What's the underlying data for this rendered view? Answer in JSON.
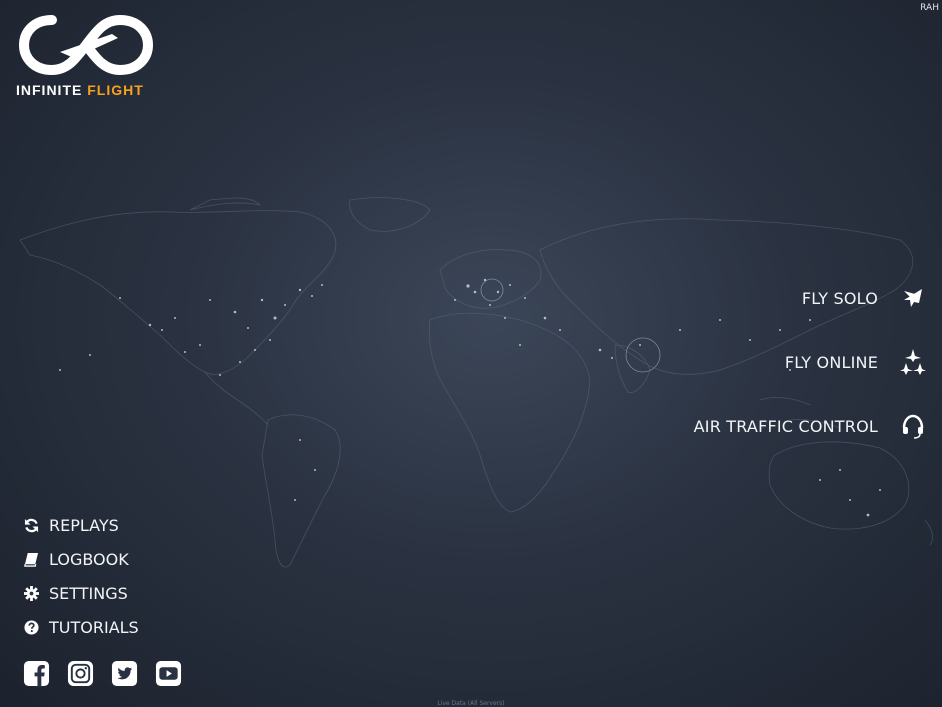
{
  "app": {
    "title": "Infinite Flight"
  },
  "user": {
    "badge": "RAH"
  },
  "logo": {
    "word1": "INFINITE",
    "word2": "FLIGHT",
    "accent_color": "#f6a21f"
  },
  "modes": [
    {
      "label": "FLY SOLO",
      "icon": "airplane-icon"
    },
    {
      "label": "FLY ONLINE",
      "icon": "multiplayer-planes-icon"
    },
    {
      "label": "AIR TRAFFIC CONTROL",
      "icon": "headset-icon"
    }
  ],
  "menu": [
    {
      "label": "REPLAYS",
      "icon": "refresh-icon"
    },
    {
      "label": "LOGBOOK",
      "icon": "book-icon"
    },
    {
      "label": "SETTINGS",
      "icon": "gear-icon"
    },
    {
      "label": "TUTORIALS",
      "icon": "question-circle-icon"
    }
  ],
  "social": [
    "facebook-icon",
    "instagram-icon",
    "twitter-icon",
    "youtube-icon"
  ],
  "footer": {
    "note": "Live Data (All Servers)"
  }
}
